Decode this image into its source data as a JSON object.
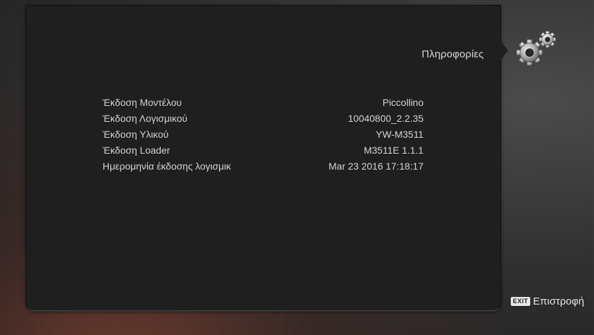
{
  "header": {
    "title": "Πληροφορίες"
  },
  "info": [
    {
      "label": "Έκδοση Μοντέλου",
      "value": "Piccollino"
    },
    {
      "label": "Έκδοση Λογισμικού",
      "value": "10040800_2.2.35"
    },
    {
      "label": "Έκδοση Υλικού",
      "value": "YW-M3511"
    },
    {
      "label": "Έκδοση Loader",
      "value": "M3511E 1.1.1"
    },
    {
      "label": "Ημερομηνία έκδοσης λογισμικ",
      "value": "Mar 23 2016 17:18:17"
    }
  ],
  "footer": {
    "exit_key": "EXIT",
    "exit_label": "Επιστροφή"
  },
  "icons": {
    "settings": "gears-icon"
  },
  "colors": {
    "panel": "#1f1f1f",
    "text": "#d4d4d4"
  }
}
